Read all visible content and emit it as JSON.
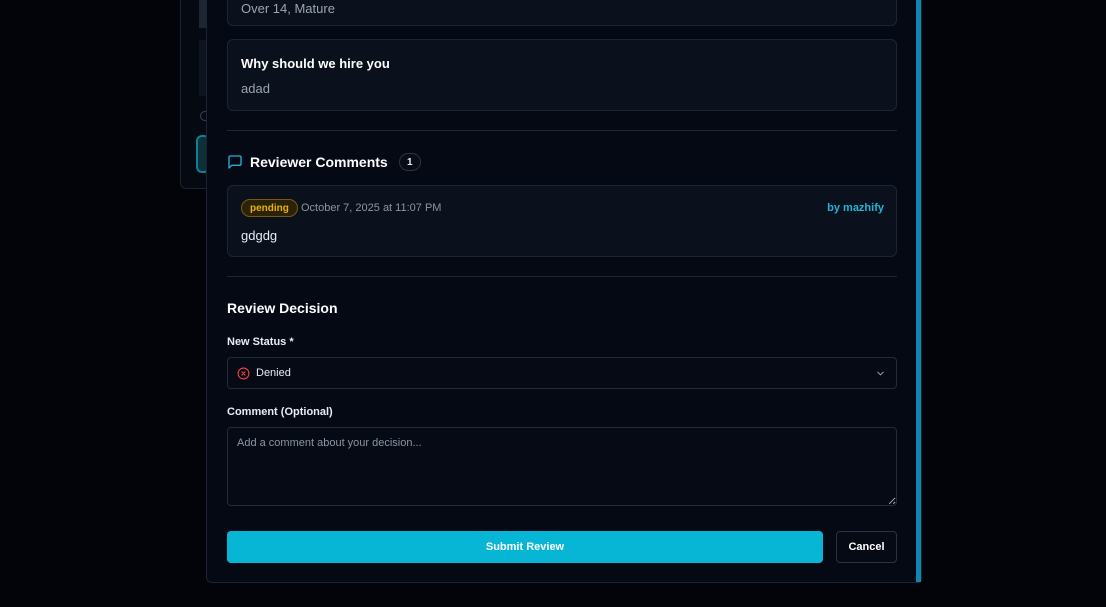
{
  "previous_answer": {
    "value": "Over 14, Mature"
  },
  "why_hire": {
    "title": "Why should we hire you",
    "value": "adad"
  },
  "reviewer_comments": {
    "title": "Reviewer Comments",
    "count": "1",
    "icon": "message-square-icon",
    "items": [
      {
        "status": "pending",
        "date": "October 7, 2025 at 11:07 PM",
        "author": "by mazhify",
        "text": "gdgdg"
      }
    ]
  },
  "review_decision": {
    "title": "Review Decision",
    "status_label": "New Status *",
    "status_value": "Denied",
    "status_icon": "x-circle-icon",
    "comment_label": "Comment (Optional)",
    "comment_placeholder": "Add a comment about your decision...",
    "submit_label": "Submit Review",
    "cancel_label": "Cancel"
  },
  "colors": {
    "accent": "#06b6d4",
    "pending": "#e7b10a",
    "denied": "#ef4444",
    "author": "#22b3d6"
  }
}
